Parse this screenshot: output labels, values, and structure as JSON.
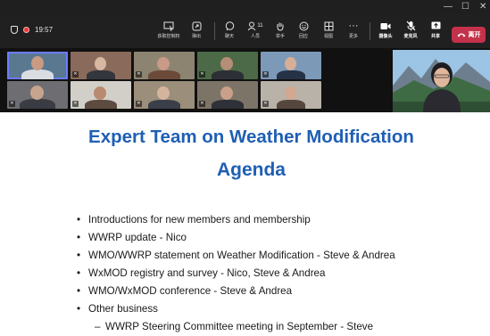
{
  "window": {
    "controls": [
      "—",
      "☐",
      "✕"
    ]
  },
  "toolbar": {
    "time": "19:57",
    "items": [
      {
        "label": "获取控制权",
        "icon": "screen-share-control-icon"
      },
      {
        "label": "弹出",
        "icon": "pop-out-icon"
      },
      {
        "label": "聊天",
        "icon": "chat-icon"
      },
      {
        "label": "人员",
        "icon": "people-icon",
        "count": "11"
      },
      {
        "label": "举手",
        "icon": "raise-hand-icon"
      },
      {
        "label": "回应",
        "icon": "reactions-icon"
      },
      {
        "label": "视图",
        "icon": "view-icon"
      },
      {
        "label": "更多",
        "icon": "more-icon"
      },
      {
        "label": "摄像头",
        "icon": "camera-icon"
      },
      {
        "label": "麦克风",
        "icon": "mic-muted-icon"
      },
      {
        "label": "共享",
        "icon": "share-icon"
      }
    ],
    "leave_label": "离开"
  },
  "slide": {
    "title": "Expert Team on Weather Modification",
    "subtitle": "Agenda",
    "items": [
      "Introductions for new members and membership",
      "WWRP update  - Nico",
      "WMO/WWRP statement on Weather Modification - Steve & Andrea",
      "WxMOD registry and survey - Nico, Steve & Andrea",
      "WMO/WxMOD conference - Steve & Andrea",
      "Other business",
      "WWRP Steering Committee meeting in September - Steve"
    ]
  },
  "colors": {
    "title_blue": "#1f5fb4",
    "leave_red": "#c4314b",
    "toolbar_bg": "#202020"
  }
}
